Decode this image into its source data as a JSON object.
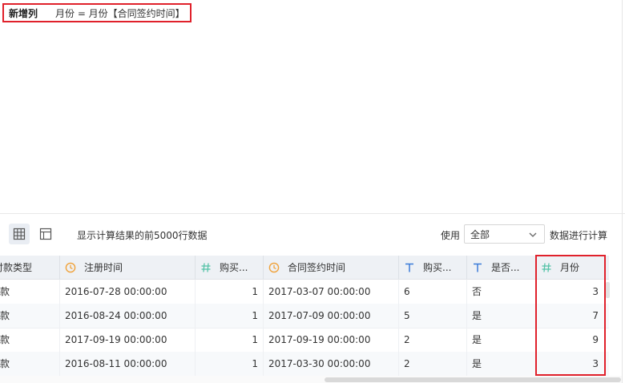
{
  "formula_bar": {
    "label": "新增列",
    "formula": "月份 = 月份【合同签约时间】"
  },
  "toolbar": {
    "hint": "显示计算结果的前5000行数据",
    "use_label": "使用",
    "scope_value": "全部",
    "calc_label": "数据进行计算"
  },
  "table": {
    "columns": [
      {
        "label": "付款类型",
        "icon": "text-icon"
      },
      {
        "label": "注册时间",
        "icon": "clock-icon"
      },
      {
        "label": "购买...",
        "icon": "hash-icon"
      },
      {
        "label": "合同签约时间",
        "icon": "clock-icon"
      },
      {
        "label": "购买...",
        "icon": "text-icon"
      },
      {
        "label": "是否...",
        "icon": "text-icon"
      },
      {
        "label": "月份",
        "icon": "hash-icon"
      }
    ],
    "rows": [
      [
        "付款",
        "2016-07-28 00:00:00",
        "1",
        "2017-03-07 00:00:00",
        "6",
        "否",
        "3"
      ],
      [
        "付款",
        "2016-08-24 00:00:00",
        "1",
        "2017-07-09 00:00:00",
        "5",
        "是",
        "7"
      ],
      [
        "付款",
        "2017-09-19 00:00:00",
        "1",
        "2017-09-19 00:00:00",
        "2",
        "是",
        "9"
      ],
      [
        "付款",
        "2016-08-11 00:00:00",
        "1",
        "2017-03-30 00:00:00",
        "2",
        "是",
        "3"
      ]
    ]
  },
  "colors": {
    "highlight": "#e0212b",
    "clock_icon": "#f0a23a",
    "hash_icon": "#56c3a8",
    "text_icon": "#3b7bd8"
  }
}
